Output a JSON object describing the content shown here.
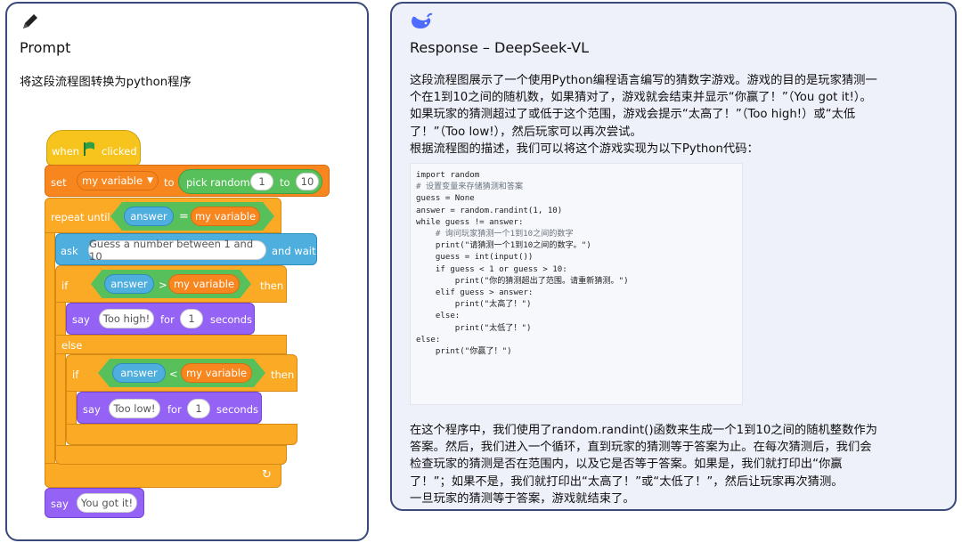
{
  "prompt": {
    "title": "Prompt",
    "instruction": "将这段流程图转换为python程序",
    "scratch": {
      "when_label": "when",
      "clicked_label": "clicked",
      "set_label": "set",
      "variable_name": "my variable",
      "to_label": "to",
      "pick_random_label": "pick random",
      "random_from": "1",
      "random_to_label": "to",
      "random_to": "10",
      "repeat_until_label": "repeat until",
      "answer_label": "answer",
      "equals_label": "=",
      "ask_label": "ask",
      "ask_text": "Guess a number between 1 and 10",
      "and_wait_label": "and wait",
      "if_label": "if",
      "greater_label": ">",
      "less_label": "<",
      "then_label": "then",
      "say_label": "say",
      "too_high": "Too high!",
      "too_low": "Too low!",
      "you_got_it": "You got it!",
      "for_label": "for",
      "seconds_value": "1",
      "seconds_label": "seconds",
      "else_label": "else",
      "flag_color": "#2ea043"
    }
  },
  "response": {
    "title": "Response – DeepSeek-VL",
    "intro_lines": [
      "这段流程图展示了一个使用Python编程语言编写的猜数字游戏。游戏的目的是玩家猜测一",
      "个在1到10之间的随机数，如果猜对了，游戏就会结束并显示“你赢了！”（You got it!）。",
      "如果玩家的猜测超过了或低于这个范围，游戏会提示“太高了！”（Too high!）或“太低",
      "了！”（Too low!），然后玩家可以再次尝试。",
      "根据流程图的描述，我们可以将这个游戏实现为以下Python代码："
    ],
    "code_lines": [
      "import random",
      "",
      "# 设置变量来存储猜测和答案",
      "guess = None",
      "answer = random.randint(1, 10)",
      "",
      "while guess != answer:",
      "    # 询问玩家猜测一个1到10之间的数字",
      "    print(\"请猜测一个1到10之间的数字。\")",
      "    guess = int(input())",
      "",
      "    if guess < 1 or guess > 10:",
      "        print(\"你的猜测超出了范围。请重新猜测。\")",
      "    elif guess > answer:",
      "        print(\"太高了！\")",
      "    else:",
      "        print(\"太低了！\")",
      "else:",
      "    print(\"你赢了！\")"
    ],
    "outro_lines": [
      "在这个程序中，我们使用了random.randint()函数来生成一个1到10之间的随机整数作为",
      "答案。然后，我们进入一个循环，直到玩家的猜测等于答案为止。在每次猜测后，我们会",
      "检查玩家的猜测是否在范围内，以及它是否等于答案。如果是，我们就打印出“你赢",
      "了！”；如果不是，我们就打印出“太高了！”或“太低了！”，然后让玩家再次猜测。",
      "一旦玩家的猜测等于答案，游戏就结束了。"
    ],
    "logo_color": "#4d6bfe"
  },
  "colors": {
    "panel_border": "#3a4a7a",
    "response_bg": "#eef0fa",
    "events": "#f6c41c",
    "variables": "#f7861e",
    "control": "#fbaa25",
    "sensing": "#4eaede",
    "looks": "#9462f5",
    "operators": "#58c05a"
  }
}
